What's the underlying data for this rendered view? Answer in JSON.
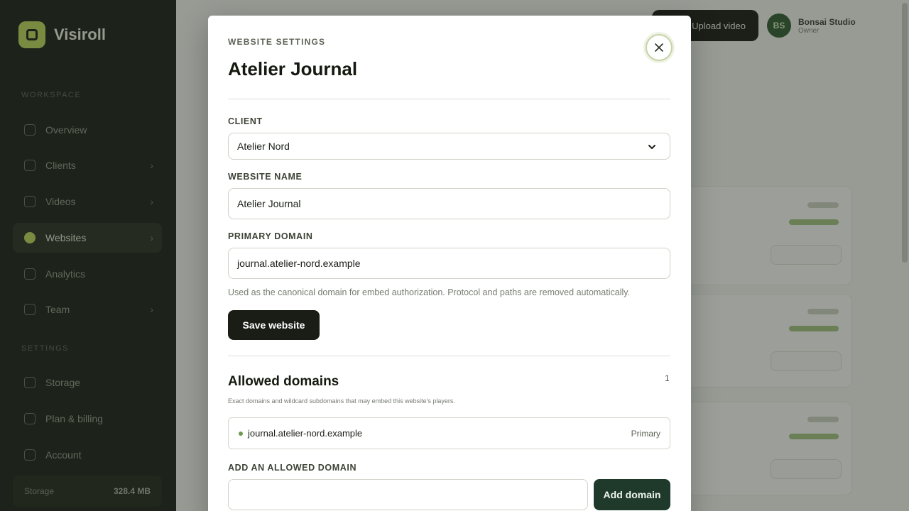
{
  "app": {
    "brand": "Visiroll",
    "nav_section_workspace": "WORKSPACE",
    "nav_section_settings": "SETTINGS",
    "nav": [
      {
        "label": "Overview"
      },
      {
        "label": "Clients"
      },
      {
        "label": "Videos"
      },
      {
        "label": "Websites"
      },
      {
        "label": "Analytics"
      },
      {
        "label": "Team"
      },
      {
        "label": "Storage"
      },
      {
        "label": "Plan & billing"
      },
      {
        "label": "Account"
      }
    ],
    "storage": {
      "label": "Storage",
      "value": "328.4 MB"
    },
    "topbar_button": "Upload video",
    "account": {
      "initials": "BS",
      "name": "Bonsai Studio",
      "role": "Owner"
    }
  },
  "modal": {
    "eyebrow": "WEBSITE SETTINGS",
    "title": "Atelier Journal",
    "client_label": "CLIENT",
    "client_value": "Atelier Nord",
    "website_name_label": "WEBSITE NAME",
    "website_name_value": "Atelier Journal",
    "primary_domain_label": "PRIMARY DOMAIN",
    "primary_domain_value": "journal.atelier-nord.example",
    "primary_domain_help": "Used as the canonical domain for embed authorization. Protocol and paths are removed automatically.",
    "save_label": "Save website",
    "allowed": {
      "title": "Allowed domains",
      "count": "1",
      "description": "Exact domains and wildcard subdomains that may embed this website's players.",
      "domains": [
        {
          "name": "journal.atelier-nord.example",
          "tag": "Primary"
        }
      ],
      "add_label": "ADD AN ALLOWED DOMAIN",
      "add_value": "",
      "add_button": "Add domain"
    }
  },
  "colors": {
    "sidebar": "#1b2018",
    "accent": "#b7d45a",
    "primary_button": "#1a1d16",
    "add_button": "#1f3a2b"
  }
}
